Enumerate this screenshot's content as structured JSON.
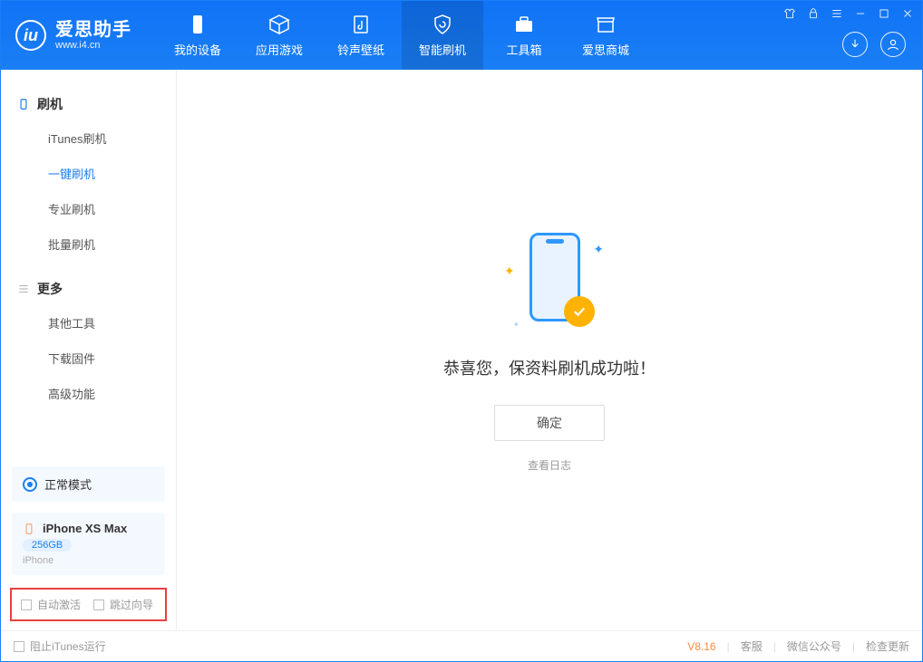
{
  "brand": {
    "name": "爱思助手",
    "url": "www.i4.cn"
  },
  "topTabs": {
    "device": "我的设备",
    "apps": "应用游戏",
    "ringtones": "铃声壁纸",
    "flash": "智能刷机",
    "toolbox": "工具箱",
    "store": "爱思商城"
  },
  "sidebar": {
    "section1": "刷机",
    "items1": {
      "itunes": "iTunes刷机",
      "oneclick": "一键刷机",
      "pro": "专业刷机",
      "batch": "批量刷机"
    },
    "section2": "更多",
    "items2": {
      "other": "其他工具",
      "firmware": "下载固件",
      "advanced": "高级功能"
    }
  },
  "mode": {
    "label": "正常模式"
  },
  "device": {
    "name": "iPhone XS Max",
    "storage": "256GB",
    "type": "iPhone"
  },
  "options": {
    "autoActivate": "自动激活",
    "skipGuide": "跳过向导"
  },
  "main": {
    "title": "恭喜您，保资料刷机成功啦！",
    "confirm": "确定",
    "viewLog": "查看日志"
  },
  "statusbar": {
    "blockItunes": "阻止iTunes运行",
    "version": "V8.16",
    "support": "客服",
    "wechat": "微信公众号",
    "update": "检查更新"
  }
}
